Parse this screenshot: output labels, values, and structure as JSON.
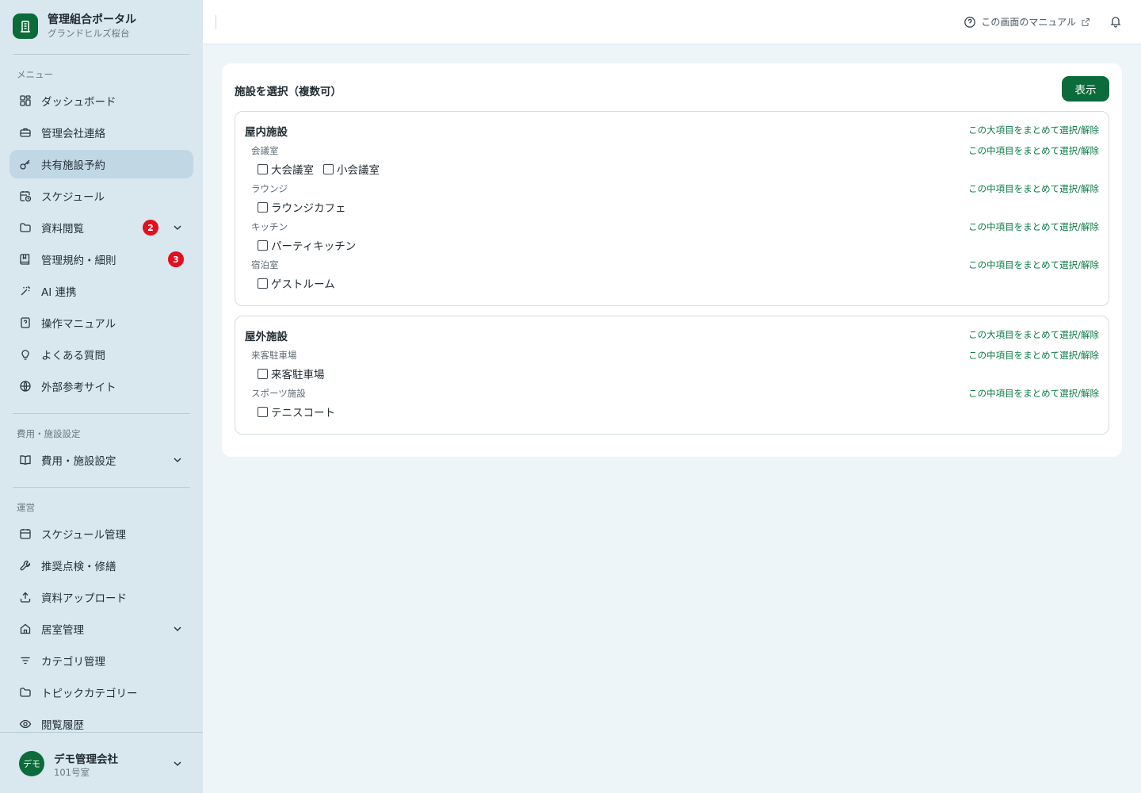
{
  "brand": {
    "title": "管理組合ポータル",
    "subtitle": "グランドヒルズ桜台"
  },
  "sidebar": {
    "menu_label": "メニュー",
    "items": [
      {
        "label": "ダッシュボード"
      },
      {
        "label": "管理会社連絡"
      },
      {
        "label": "共有施設予約"
      },
      {
        "label": "スケジュール"
      },
      {
        "label": "資料閲覧",
        "badge": "2"
      },
      {
        "label": "管理規約・細則",
        "badge": "3"
      },
      {
        "label": "AI 連携"
      },
      {
        "label": "操作マニュアル"
      },
      {
        "label": "よくある質問"
      },
      {
        "label": "外部参考サイト"
      }
    ],
    "cost_section_label": "費用・施設設定",
    "cost_items": [
      {
        "label": "費用・施設設定"
      }
    ],
    "ops_section_label": "運営",
    "ops_items": [
      {
        "label": "スケジュール管理"
      },
      {
        "label": "推奨点検・修繕"
      },
      {
        "label": "資料アップロード"
      },
      {
        "label": "居室管理"
      },
      {
        "label": "カテゴリ管理"
      },
      {
        "label": "トピックカテゴリー"
      },
      {
        "label": "閲覧履歴"
      }
    ]
  },
  "user": {
    "avatar": "デモ",
    "name": "デモ管理会社",
    "room": "101号室"
  },
  "header": {
    "manual_label": "この画面のマニュアル"
  },
  "main": {
    "title": "施設を選択（複数可）",
    "show_button": "表示",
    "groups": [
      {
        "title": "屋内施設",
        "toggle": "この大項目をまとめて選択/解除",
        "subs": [
          {
            "label": "会議室",
            "toggle": "この中項目をまとめて選択/解除",
            "options": [
              "大会議室",
              "小会議室"
            ]
          },
          {
            "label": "ラウンジ",
            "toggle": "この中項目をまとめて選択/解除",
            "options": [
              "ラウンジカフェ"
            ]
          },
          {
            "label": "キッチン",
            "toggle": "この中項目をまとめて選択/解除",
            "options": [
              "パーティキッチン"
            ]
          },
          {
            "label": "宿泊室",
            "toggle": "この中項目をまとめて選択/解除",
            "options": [
              "ゲストルーム"
            ]
          }
        ]
      },
      {
        "title": "屋外施設",
        "toggle": "この大項目をまとめて選択/解除",
        "subs": [
          {
            "label": "来客駐車場",
            "toggle": "この中項目をまとめて選択/解除",
            "options": [
              "来客駐車場"
            ]
          },
          {
            "label": "スポーツ施設",
            "toggle": "この中項目をまとめて選択/解除",
            "options": [
              "テニスコート"
            ]
          }
        ]
      }
    ]
  }
}
